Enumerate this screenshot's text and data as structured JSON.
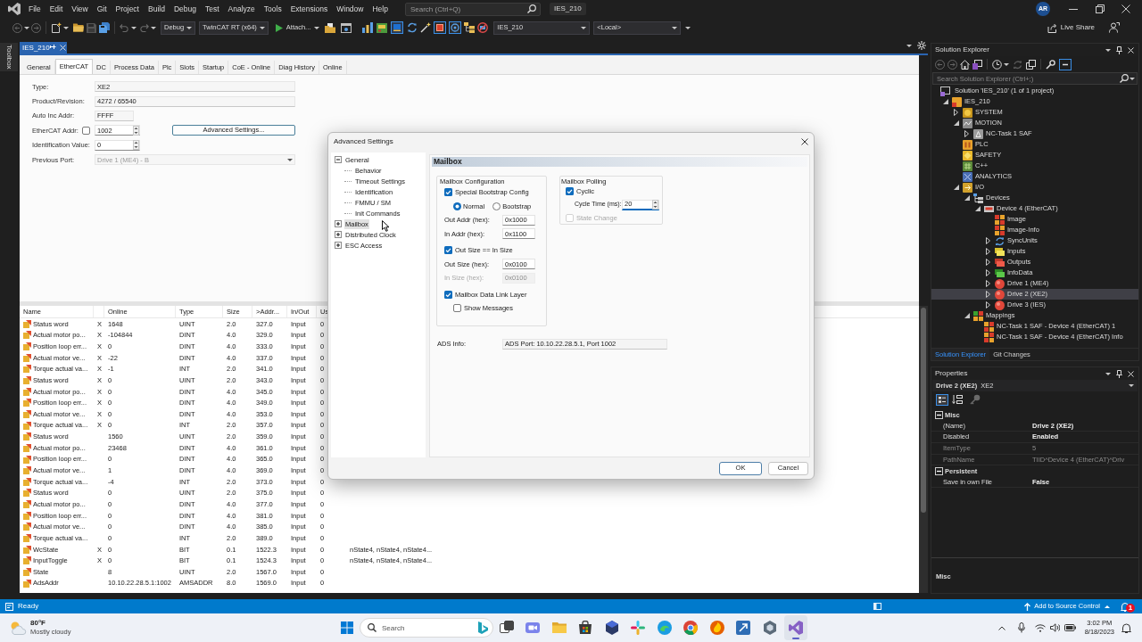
{
  "menu_bar": {
    "items": [
      "File",
      "Edit",
      "View",
      "Git",
      "Project",
      "Build",
      "Debug",
      "Test",
      "Analyze",
      "Tools",
      "Extensions",
      "Window",
      "Help"
    ],
    "search": {
      "placeholder": "Search (Ctrl+Q)"
    },
    "solution_title": "IES_210",
    "account": "AR"
  },
  "toolbar": {
    "configuration": "Debug",
    "platform": "TwinCAT RT (x64)",
    "attach": "Attach...",
    "target_project": "IES_210",
    "target_system": "<Local>",
    "live_share": "Live Share"
  },
  "toolbox": {
    "label": "Toolbox"
  },
  "document_tab": {
    "title": "IES_210"
  },
  "editor_tabs": [
    {
      "label": "General",
      "selected": false
    },
    {
      "label": "EtherCAT",
      "selected": true
    },
    {
      "label": "DC",
      "selected": false
    },
    {
      "label": "Process Data",
      "selected": false
    },
    {
      "label": "Plc",
      "selected": false
    },
    {
      "label": "Slots",
      "selected": false
    },
    {
      "label": "Startup",
      "selected": false
    },
    {
      "label": "CoE - Online",
      "selected": false
    },
    {
      "label": "Diag History",
      "selected": false
    },
    {
      "label": "Online",
      "selected": false
    }
  ],
  "device_form": {
    "fields": [
      {
        "label": "Type:",
        "value": "XE2",
        "kind": "text",
        "disabled": false
      },
      {
        "label": "Product/Revision:",
        "value": "4272 / 65540",
        "kind": "text",
        "disabled": false
      },
      {
        "label": "Auto Inc Addr:",
        "value": "FFFF",
        "kind": "short",
        "disabled": false
      },
      {
        "label": "EtherCAT Addr:",
        "value": "1002",
        "kind": "spin",
        "disabled": false,
        "checkbox": {
          "checked": false
        },
        "button": "Advanced Settings..."
      },
      {
        "label": "Identification Value:",
        "value": "0",
        "kind": "spin",
        "disabled": false
      },
      {
        "label": "Previous Port:",
        "value": "Drive 1 (ME4) - B",
        "kind": "dropdown",
        "disabled": true
      }
    ]
  },
  "process_data": {
    "columns": [
      "Name",
      "Online",
      "Type",
      "Size",
      ">Addr...",
      "In/Out",
      "Us"
    ],
    "rows": [
      {
        "name": "Status word",
        "column_2": "X",
        "online": "1648",
        "type": "UINT",
        "size": "2.0",
        "addr": "327.0",
        "in_out": "Input",
        "column_8": "0"
      },
      {
        "name": "Actual motor po...",
        "column_2": "X",
        "online": "-104844",
        "type": "DINT",
        "size": "4.0",
        "addr": "329.0",
        "in_out": "Input",
        "column_8": "0"
      },
      {
        "name": "Position loop err...",
        "column_2": "X",
        "online": "0",
        "type": "DINT",
        "size": "4.0",
        "addr": "333.0",
        "in_out": "Input",
        "column_8": "0"
      },
      {
        "name": "Actual motor ve...",
        "column_2": "X",
        "online": "-22",
        "type": "DINT",
        "size": "4.0",
        "addr": "337.0",
        "in_out": "Input",
        "column_8": "0"
      },
      {
        "name": "Torque actual va...",
        "column_2": "X",
        "online": "-1",
        "type": "INT",
        "size": "2.0",
        "addr": "341.0",
        "in_out": "Input",
        "column_8": "0"
      },
      {
        "name": "Status word",
        "column_2": "X",
        "online": "0",
        "type": "UINT",
        "size": "2.0",
        "addr": "343.0",
        "in_out": "Input",
        "column_8": "0"
      },
      {
        "name": "Actual motor po...",
        "column_2": "X",
        "online": "0",
        "type": "DINT",
        "size": "4.0",
        "addr": "345.0",
        "in_out": "Input",
        "column_8": "0"
      },
      {
        "name": "Position loop err...",
        "column_2": "X",
        "online": "0",
        "type": "DINT",
        "size": "4.0",
        "addr": "349.0",
        "in_out": "Input",
        "column_8": "0"
      },
      {
        "name": "Actual motor ve...",
        "column_2": "X",
        "online": "0",
        "type": "DINT",
        "size": "4.0",
        "addr": "353.0",
        "in_out": "Input",
        "column_8": "0"
      },
      {
        "name": "Torque actual va...",
        "column_2": "X",
        "online": "0",
        "type": "INT",
        "size": "2.0",
        "addr": "357.0",
        "in_out": "Input",
        "column_8": "0"
      },
      {
        "name": "Status word",
        "online": "1560",
        "type": "UINT",
        "size": "2.0",
        "addr": "359.0",
        "in_out": "Input",
        "column_8": "0"
      },
      {
        "name": "Actual motor po...",
        "online": "23468",
        "type": "DINT",
        "size": "4.0",
        "addr": "361.0",
        "in_out": "Input",
        "column_8": "0"
      },
      {
        "name": "Position loop err...",
        "online": "0",
        "type": "DINT",
        "size": "4.0",
        "addr": "365.0",
        "in_out": "Input",
        "column_8": "0"
      },
      {
        "name": "Actual motor ve...",
        "online": "1",
        "type": "DINT",
        "size": "4.0",
        "addr": "369.0",
        "in_out": "Input",
        "column_8": "0"
      },
      {
        "name": "Torque actual va...",
        "online": "-4",
        "type": "INT",
        "size": "2.0",
        "addr": "373.0",
        "in_out": "Input",
        "column_8": "0"
      },
      {
        "name": "Status word",
        "online": "0",
        "type": "UINT",
        "size": "2.0",
        "addr": "375.0",
        "in_out": "Input",
        "column_8": "0"
      },
      {
        "name": "Actual motor po...",
        "online": "0",
        "type": "DINT",
        "size": "4.0",
        "addr": "377.0",
        "in_out": "Input",
        "column_8": "0"
      },
      {
        "name": "Position loop err...",
        "online": "0",
        "type": "DINT",
        "size": "4.0",
        "addr": "381.0",
        "in_out": "Input",
        "column_8": "0"
      },
      {
        "name": "Actual motor ve...",
        "online": "0",
        "type": "DINT",
        "size": "4.0",
        "addr": "385.0",
        "in_out": "Input",
        "column_8": "0"
      },
      {
        "name": "Torque actual va...",
        "online": "0",
        "type": "INT",
        "size": "2.0",
        "addr": "389.0",
        "in_out": "Input",
        "column_8": "0"
      },
      {
        "name": "WcState",
        "column_2": "X",
        "online": "0",
        "type": "BIT",
        "size": "0.1",
        "addr": "1522.3",
        "in_out": "Input",
        "column_8": "0",
        "column_9": "nState4, nState4, nState4..."
      },
      {
        "name": "InputToggle",
        "column_2": "X",
        "online": "0",
        "type": "BIT",
        "size": "0.1",
        "addr": "1524.3",
        "in_out": "Input",
        "column_8": "0",
        "column_9": "nState4, nState4, nState4..."
      },
      {
        "name": "State",
        "online": "8",
        "type": "UINT",
        "size": "2.0",
        "addr": "1567.0",
        "in_out": "Input",
        "column_8": "0"
      },
      {
        "name": "AdsAddr",
        "online": "10.10.22.28.5.1:1002",
        "type": "AMSADDR",
        "size": "8.0",
        "addr": "1569.0",
        "in_out": "Input",
        "column_8": "0"
      }
    ]
  },
  "advanced_settings_dialog": {
    "title": "Advanced Settings",
    "tree": [
      {
        "label": "General",
        "expanded": true,
        "selected": false,
        "children": [
          {
            "label": "Behavior",
            "selected": false
          },
          {
            "label": "Timeout Settings",
            "selected": false
          },
          {
            "label": "Identification",
            "selected": false
          },
          {
            "label": "FMMU / SM",
            "selected": false
          },
          {
            "label": "Init Commands",
            "selected": false
          }
        ]
      },
      {
        "label": "Mailbox",
        "expanded": false,
        "selected": true
      },
      {
        "label": "Distributed Clock",
        "expanded": false,
        "selected": false
      },
      {
        "label": "ESC Access",
        "expanded": false,
        "selected": false
      }
    ],
    "section_title": "Mailbox",
    "groups": [
      {
        "title": "Mailbox Configuration",
        "items": [
          {
            "kind": "checkbox",
            "label": "Special Bootstrap Config",
            "checked": true,
            "disabled": false,
            "children": [
              {
                "kind": "radios",
                "options": [
                  {
                    "label": "Normal",
                    "selected": true
                  },
                  {
                    "label": "Bootstrap",
                    "selected": false
                  }
                ]
              }
            ]
          },
          {
            "kind": "field",
            "label": "Out Addr (hex):",
            "value": "0x1000",
            "disabled": false,
            "focused": false
          },
          {
            "kind": "field",
            "label": "In Addr (hex):",
            "value": "0x1100",
            "disabled": false,
            "focused": false
          },
          {
            "kind": "checkbox",
            "label": "Out Size == In Size",
            "checked": true,
            "disabled": false
          },
          {
            "kind": "field",
            "label": "Out Size (hex):",
            "value": "0x0100",
            "disabled": false,
            "focused": false
          },
          {
            "kind": "field",
            "label": "In Size (hex):",
            "value": "0x0100",
            "disabled": true,
            "focused": false
          },
          {
            "kind": "checkbox",
            "label": "Mailbox Data Link Layer",
            "checked": true,
            "disabled": false,
            "children": [
              {
                "kind": "checkbox",
                "label": "Show Messages",
                "checked": false,
                "disabled": false
              }
            ]
          }
        ]
      },
      {
        "title": "Mailbox Polling",
        "items": [
          {
            "kind": "checkbox",
            "label": "Cyclic",
            "checked": true,
            "disabled": false,
            "children": [
              {
                "kind": "spin",
                "label": "Cycle Time (ms):",
                "value": "20",
                "disabled": false,
                "focused": true
              }
            ]
          },
          {
            "kind": "checkbox",
            "label": "State Change",
            "checked": false,
            "disabled": true
          }
        ]
      }
    ],
    "ads_info": {
      "label": "ADS Info:",
      "value": "ADS Port: 10.10.22.28.5.1, Port 1002"
    },
    "buttons": [
      {
        "label": "OK",
        "default": true
      },
      {
        "label": "Cancel",
        "default": false
      }
    ]
  },
  "solution_explorer": {
    "title": "Solution Explorer",
    "search": {
      "placeholder": "Search Solution Explorer (Ctrl+;)"
    },
    "tree": [
      {
        "label": "Solution 'IES_210' (1 of 1 project)",
        "kind": "solution",
        "selected": false,
        "children": [
          {
            "label": "IES_210",
            "kind": "project",
            "expanded": true,
            "selected": false,
            "children": [
              {
                "label": "SYSTEM",
                "kind": "system",
                "expanded": false,
                "selected": false
              },
              {
                "label": "MOTION",
                "kind": "motion",
                "expanded": true,
                "selected": false,
                "children": [
                  {
                    "label": "NC-Task 1 SAF",
                    "kind": "task",
                    "expanded": false,
                    "selected": false
                  }
                ]
              },
              {
                "label": "PLC",
                "kind": "plc",
                "selected": false
              },
              {
                "label": "SAFETY",
                "kind": "safety",
                "selected": false
              },
              {
                "label": "C++",
                "kind": "cpp",
                "selected": false
              },
              {
                "label": "ANALYTICS",
                "kind": "analytics",
                "selected": false
              },
              {
                "label": "I/O",
                "kind": "io",
                "expanded": true,
                "selected": false,
                "children": [
                  {
                    "label": "Devices",
                    "kind": "devices",
                    "expanded": true,
                    "selected": false,
                    "children": [
                      {
                        "label": "Device 4 (EtherCAT)",
                        "kind": "ethercat",
                        "expanded": true,
                        "selected": false,
                        "children": [
                          {
                            "label": "Image",
                            "kind": "image",
                            "selected": false
                          },
                          {
                            "label": "Image-Info",
                            "kind": "image",
                            "selected": false
                          },
                          {
                            "label": "SyncUnits",
                            "kind": "sync",
                            "expanded": false,
                            "selected": false
                          },
                          {
                            "label": "Inputs",
                            "kind": "inputs",
                            "expanded": false,
                            "selected": false
                          },
                          {
                            "label": "Outputs",
                            "kind": "outputs",
                            "expanded": false,
                            "selected": false
                          },
                          {
                            "label": "InfoData",
                            "kind": "infodata",
                            "expanded": false,
                            "selected": false
                          },
                          {
                            "label": "Drive 1 (ME4)",
                            "kind": "drive",
                            "expanded": false,
                            "selected": false
                          },
                          {
                            "label": "Drive 2 (XE2)",
                            "kind": "drive",
                            "expanded": false,
                            "selected": true
                          },
                          {
                            "label": "Drive 3 (IES)",
                            "kind": "drive",
                            "expanded": false,
                            "selected": false
                          }
                        ]
                      }
                    ]
                  },
                  {
                    "label": "Mappings",
                    "kind": "mappings",
                    "expanded": true,
                    "selected": false,
                    "children": [
                      {
                        "label": "NC-Task 1 SAF - Device 4 (EtherCAT) 1",
                        "kind": "mapping",
                        "selected": false
                      },
                      {
                        "label": "NC-Task 1 SAF - Device 4 (EtherCAT) Info",
                        "kind": "mapping",
                        "selected": false
                      }
                    ]
                  }
                ]
              }
            ]
          }
        ]
      }
    ],
    "tabs": [
      {
        "label": "Solution Explorer",
        "selected": true
      },
      {
        "label": "Git Changes",
        "selected": false
      }
    ]
  },
  "properties": {
    "title": "Properties",
    "object": {
      "name": "Drive 2 (XE2)",
      "type": "XE2"
    },
    "categories": [
      {
        "label": "Misc",
        "expanded": true,
        "rows": [
          {
            "name": "(Name)",
            "value": "Drive 2 (XE2)",
            "read_only": false
          },
          {
            "name": "Disabled",
            "value": "Enabled",
            "read_only": false
          },
          {
            "name": "ItemType",
            "value": "5",
            "read_only": true
          },
          {
            "name": "PathName",
            "value": "TIID^Device 4 (EtherCAT)^Driv",
            "read_only": true
          }
        ]
      },
      {
        "label": "Persistent",
        "expanded": true,
        "rows": [
          {
            "name": "Save in own File",
            "value": "False",
            "read_only": false
          }
        ]
      }
    ],
    "description": {
      "title": "Misc"
    }
  },
  "status_bar": {
    "status": "Ready",
    "source_control": "Add to Source Control",
    "notification_count": "1"
  },
  "taskbar": {
    "weather": {
      "temperature": "80°F",
      "condition": "Mostly cloudy"
    },
    "search": {
      "placeholder": "Search"
    },
    "apps": [
      {
        "active": false
      },
      {
        "active": false
      },
      {
        "active": false
      },
      {
        "active": false
      },
      {
        "active": false
      },
      {
        "active": false
      },
      {
        "active": false
      },
      {
        "active": false
      },
      {
        "active": false
      },
      {
        "active": false
      },
      {
        "active": false
      },
      {
        "active": true
      }
    ],
    "time": "3:02 PM",
    "date": "8/18/2023"
  }
}
